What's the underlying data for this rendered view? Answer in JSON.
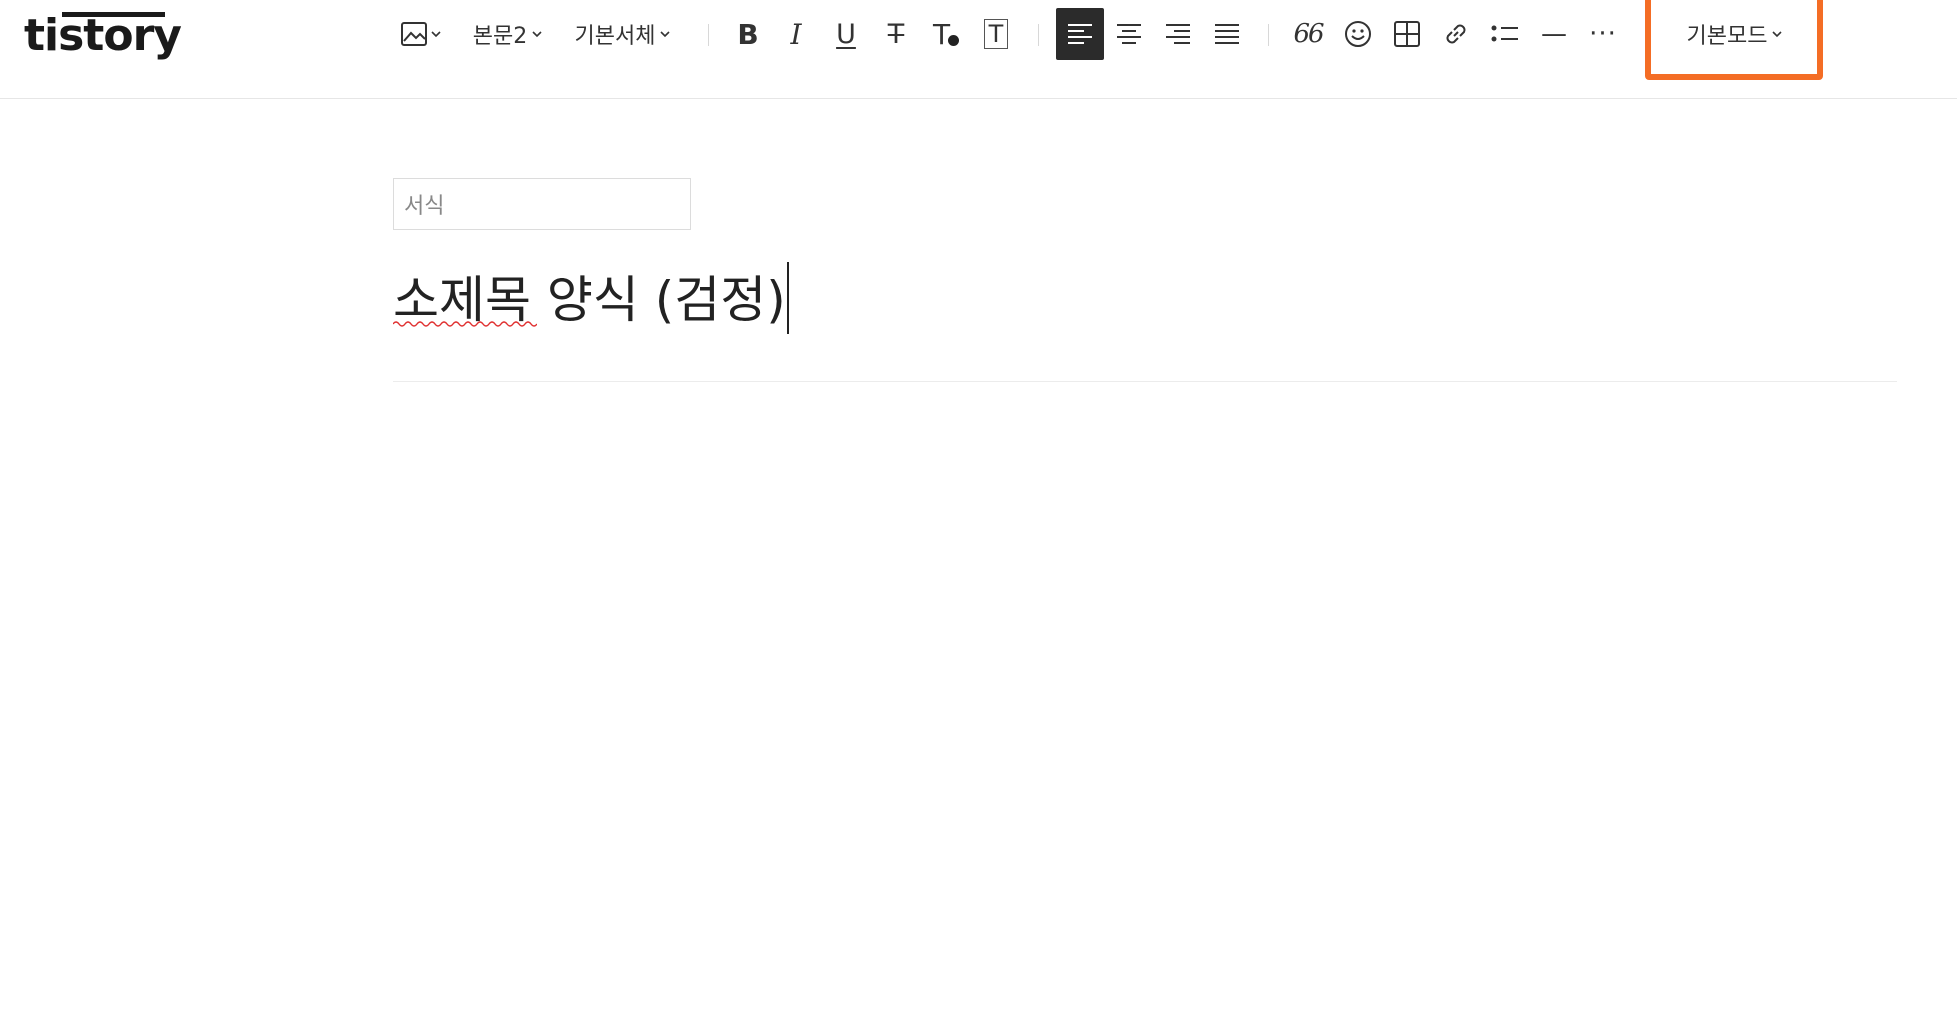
{
  "header": {
    "logo_text": "tistory",
    "toolbar": {
      "image_icon": "image-icon",
      "paragraph_style": "본문2",
      "font_family": "기본서체",
      "bold_label": "B",
      "italic_label": "I",
      "underline_label": "U",
      "strike_label": "T",
      "text_color_label": "T",
      "bg_color_label": "T",
      "align": [
        "align-left-icon",
        "align-center-icon",
        "align-right-icon",
        "align-justify-icon"
      ],
      "quote_label": "66",
      "emoticon_icon": "smile-icon",
      "table_icon": "table-icon",
      "link_icon": "link-icon",
      "list_icon": "list-icon",
      "hr_label": "—",
      "more_label": "···",
      "mode_label": "기본모드"
    },
    "accent_color": "#f46d25"
  },
  "editor": {
    "style_box_text": "서식",
    "heading_text": "소제목 양식 (검정)"
  }
}
